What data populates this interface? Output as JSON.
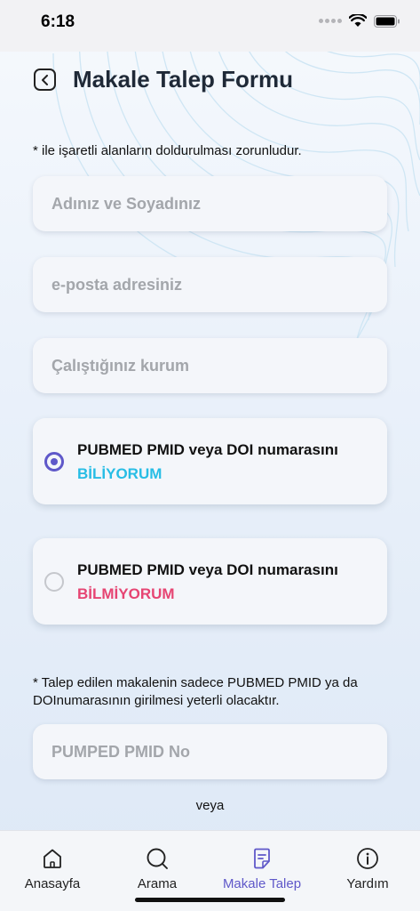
{
  "status": {
    "time": "6:18"
  },
  "header": {
    "title": "Makale Talep Formu"
  },
  "form": {
    "required_note": "* ile işaretli alanların doldurulması zorunludur.",
    "name_placeholder": "Adınız ve Soyadınız",
    "email_placeholder": "e-posta adresiniz",
    "institution_placeholder": "Çalıştığınız kurum",
    "options": [
      {
        "title": "PUBMED PMID veya DOI numarasını",
        "choice": "BİLİYORUM",
        "selected": true,
        "color": "#27bde5"
      },
      {
        "title": "PUBMED PMID veya DOI numarasını",
        "choice": "BİLMİYORUM",
        "selected": false,
        "color": "#e64573"
      }
    ],
    "pmid_note": "* Talep edilen makalenin sadece PUBMED PMID ya da DOInumarasının girilmesi yeterli olacaktır.",
    "pmid_placeholder": "PUMPED PMID No",
    "or_text": "veya"
  },
  "tabbar": {
    "tabs": [
      {
        "label": "Anasayfa",
        "icon": "home-icon"
      },
      {
        "label": "Arama",
        "icon": "search-icon"
      },
      {
        "label": "Makale Talep",
        "icon": "document-icon",
        "active": true
      },
      {
        "label": "Yardım",
        "icon": "info-icon"
      }
    ]
  },
  "colors": {
    "accent": "#5f58c9",
    "know": "#27bde5",
    "dont_know": "#e64573"
  }
}
